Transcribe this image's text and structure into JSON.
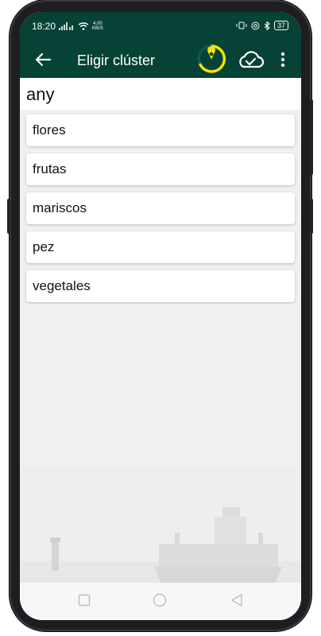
{
  "status": {
    "time": "18:20",
    "net_speed_value": "4.00",
    "net_speed_unit": "KB/S",
    "battery": "37"
  },
  "appbar": {
    "title": "Eligir clúster"
  },
  "filter": {
    "value": "any"
  },
  "clusters": [
    "flores",
    "frutas",
    "mariscos",
    "pez",
    "vegetales"
  ],
  "colors": {
    "primary": "#064236",
    "accent": "#f4e400",
    "background": "#f1f0ef"
  },
  "icons": {
    "back": "arrow-left-icon",
    "timer": "timer-clock-icon",
    "cloud": "cloud-check-icon",
    "menu": "more-vert-icon",
    "nav_recent": "square-icon",
    "nav_home": "circle-icon",
    "nav_back": "triangle-back-icon"
  }
}
